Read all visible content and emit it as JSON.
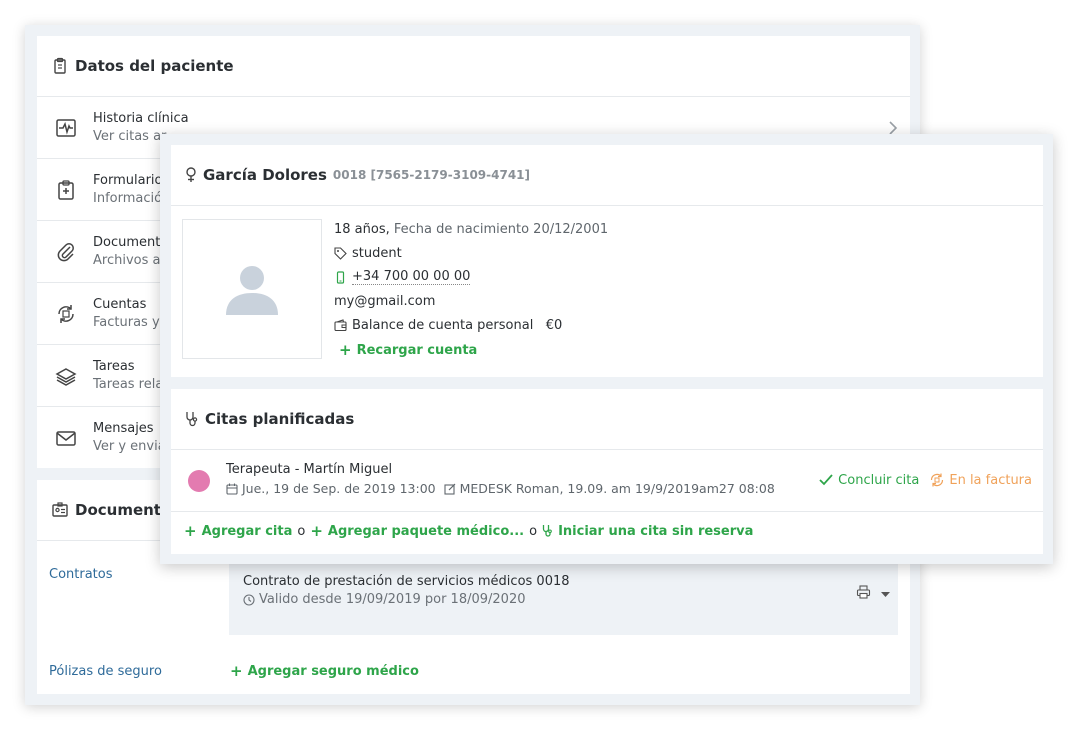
{
  "patient_data": {
    "title": "Datos del paciente",
    "items": [
      {
        "title": "Historia clínica",
        "subtitle": "Ver citas ar..."
      },
      {
        "title": "Formulario",
        "subtitle": "Informació"
      },
      {
        "title": "Documento",
        "subtitle": "Archivos ad"
      },
      {
        "title": "Cuentas",
        "subtitle": "Facturas y l"
      },
      {
        "title": "Tareas",
        "subtitle": "Tareas rela"
      },
      {
        "title": "Mensajes",
        "subtitle": "Ver y envia"
      }
    ]
  },
  "documents": {
    "title": "Documentos",
    "contracts_label": "Contratos",
    "contract_title": "Contrato de prestación de servicios médicos 0018",
    "contract_validity": "Valido desde 19/09/2019 por 18/09/2020",
    "insurance_label": "Pólizas de seguro",
    "add_insurance": "Agregar seguro médico"
  },
  "patient": {
    "name": "García Dolores",
    "id": "0018 [7565-2179-3109-4741]",
    "age": "18 años,",
    "birth": "Fecha de nacimiento 20/12/2001",
    "tag": "student",
    "phone": "+34 700 00 00 00",
    "email": "my@gmail.com",
    "balance_label": "Balance de cuenta personal",
    "balance_value": "€0",
    "recharge": "Recargar cuenta"
  },
  "appointments": {
    "title": "Citas planificadas",
    "item": {
      "title": "Terapeuta - Martín Miguel",
      "date": "Jue., 19 de Sep. de 2019 13:00",
      "edited": "MEDESK Roman, 19.09. am 19/9/2019am27 08:08",
      "conclude": "Concluir cita",
      "invoice": "En la factura"
    },
    "add_appointment": "Agregar cita",
    "or": "o",
    "add_package": "Agregar paquete médico...",
    "walk_in": "Iniciar una cita sin reserva"
  },
  "colors": {
    "accent_green": "#2ea54a",
    "link_blue": "#2f6b9a",
    "orange": "#f0a25a",
    "appointment_dot": "#e37bb0"
  }
}
